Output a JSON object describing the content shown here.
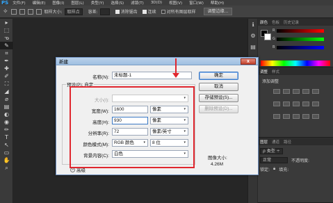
{
  "menubar": {
    "logo": "PS",
    "items": [
      "文件(F)",
      "编辑(E)",
      "图像(I)",
      "图层(L)",
      "类型(Y)",
      "选择(S)",
      "滤镜(T)",
      "3D(D)",
      "视图(V)",
      "窗口(W)",
      "帮助(H)"
    ]
  },
  "options": {
    "size_label": "取样大小:",
    "size_value": "取样点",
    "tolerance_label": "容差:",
    "antialias_label": "消除锯齿",
    "contiguous_label": "连续",
    "all_layers_label": "对所有图层取样",
    "refine_button": "调整边缘..."
  },
  "tools": [
    "▸",
    "⬚",
    "ᓀ",
    "✎",
    "⌗",
    "✒",
    "✚",
    "✐",
    "⛶",
    "◢",
    "⌀",
    "▤",
    "◐",
    "◉",
    "✏",
    "T",
    "↖",
    "▭",
    "✋",
    "⌕"
  ],
  "dialog": {
    "title": "新建",
    "close": "x",
    "name_label": "名称(N):",
    "name_value": "未标题-1",
    "preset_label": "预设(P):",
    "preset_value": "自定",
    "size_label": "大小(I):",
    "width_label": "宽度(W):",
    "width_value": "1600",
    "width_unit": "像素",
    "height_label": "高度(H):",
    "height_value": "930",
    "height_unit": "像素",
    "resolution_label": "分辨率(R):",
    "resolution_value": "72",
    "resolution_unit": "像素/英寸",
    "color_mode_label": "颜色模式(M):",
    "color_mode_value": "RGB 颜色",
    "bit_depth_value": "8 位",
    "background_label": "背景内容(C):",
    "background_value": "白色",
    "advanced_label": "高级",
    "ok_button": "确定",
    "cancel_button": "取消",
    "save_preset_button": "存储预设(S)...",
    "delete_preset_button": "删除预设(D)...",
    "image_size_label": "图像大小:",
    "image_size_value": "4.26M"
  },
  "panels": {
    "color_tabs": [
      "颜色",
      "色板",
      "历史记录"
    ],
    "color_sliders": [
      "R",
      "G",
      "B"
    ],
    "styles_tabs": [
      "调整",
      "样式"
    ],
    "styles_sub": "添加调整",
    "layers_tabs": [
      "图层",
      "通道",
      "路径"
    ],
    "layers_kind": "ρ 类型 ÷",
    "layers_mode": "正常",
    "layers_opacity": "不透明度:",
    "layers_lock": "锁定:",
    "layers_fill": "填充:"
  },
  "colors": {
    "annotation": "#e0262e",
    "accent": "#31a8ff"
  }
}
